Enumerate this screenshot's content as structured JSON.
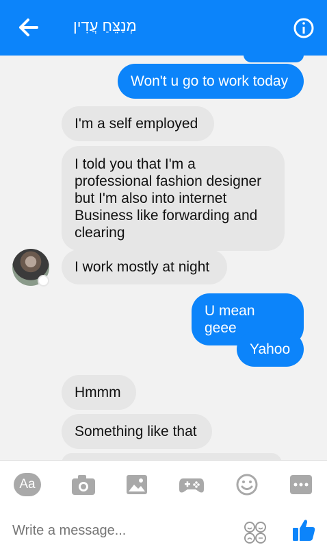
{
  "header": {
    "title": "מְנַצֵּחַ עֲדִין",
    "back_icon": "arrow-left-icon",
    "info_icon": "info-icon"
  },
  "messages": [
    {
      "direction": "outgoing",
      "text": "Won't u go to work today"
    },
    {
      "direction": "incoming",
      "text": "I'm a self employed"
    },
    {
      "direction": "incoming",
      "text": "I told you that I'm a professional fashion designer but I'm also into internet Business like forwarding and clearing"
    },
    {
      "direction": "incoming",
      "text": "I work mostly at night"
    },
    {
      "direction": "outgoing",
      "text": "U mean geee"
    },
    {
      "direction": "outgoing",
      "text": "Yahoo"
    },
    {
      "direction": "incoming",
      "text": "Hmmm"
    },
    {
      "direction": "incoming",
      "text": "Something like that"
    }
  ],
  "toolbar": {
    "items": [
      {
        "name": "text-style-icon",
        "label": "Aa"
      },
      {
        "name": "camera-icon"
      },
      {
        "name": "gallery-icon"
      },
      {
        "name": "game-icon"
      },
      {
        "name": "emoji-icon"
      },
      {
        "name": "more-icon"
      }
    ]
  },
  "composer": {
    "placeholder": "Write a message...",
    "emoji_icon": "emoji-stickers-icon",
    "like_icon": "thumbs-up-icon"
  },
  "colors": {
    "accent": "#0c84fa",
    "incoming_bubble": "#e6e6e6",
    "background": "#f2f2f2"
  }
}
